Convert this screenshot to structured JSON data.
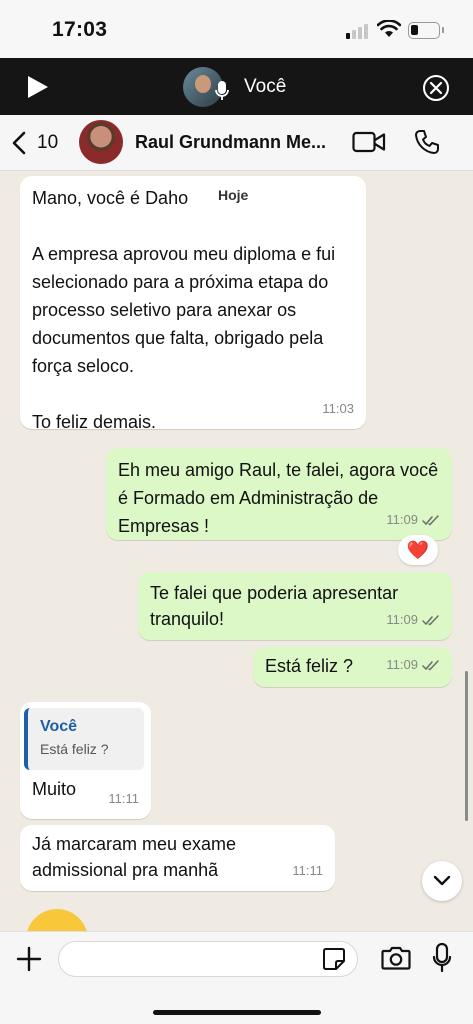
{
  "status_bar": {
    "time": "17:03"
  },
  "audio_bar": {
    "label": "Você"
  },
  "chat_header": {
    "back_count": "10",
    "contact_name": "Raul Grundmann Me..."
  },
  "date_chip": "Hoje",
  "messages": [
    {
      "direction": "in",
      "text": "Mano, você é Daho\n\nA empresa aprovou meu diploma e fui selecionado para a próxima etapa do processo seletivo para anexar os documentos que falta, obrigado pela força seloco.\n\nTo feliz demais.",
      "time": "11:03"
    },
    {
      "direction": "out",
      "text": "Eh meu amigo Raul, te falei, agora você é Formado em Administração de Empresas !",
      "time": "11:09",
      "reaction": "❤️"
    },
    {
      "direction": "out",
      "text": "Te falei que poderia apresentar tranquilo!",
      "time": "11:09"
    },
    {
      "direction": "out",
      "text": "Está feliz ?",
      "time": "11:09"
    },
    {
      "direction": "in",
      "quote_author": "Você",
      "quote_text": "Está feliz ?",
      "text": "Muito",
      "time": "11:11"
    },
    {
      "direction": "in",
      "text": "Já marcaram meu exame admissional pra manhã",
      "time": "11:11"
    }
  ],
  "input": {
    "placeholder": "",
    "value": ""
  },
  "colors": {
    "outgoing_bubble": "#dcf8c6",
    "incoming_bubble": "#ffffff",
    "quote_accent": "#1f5fa8",
    "background": "#efeae2",
    "read_ticks": "#6b6b6b"
  }
}
